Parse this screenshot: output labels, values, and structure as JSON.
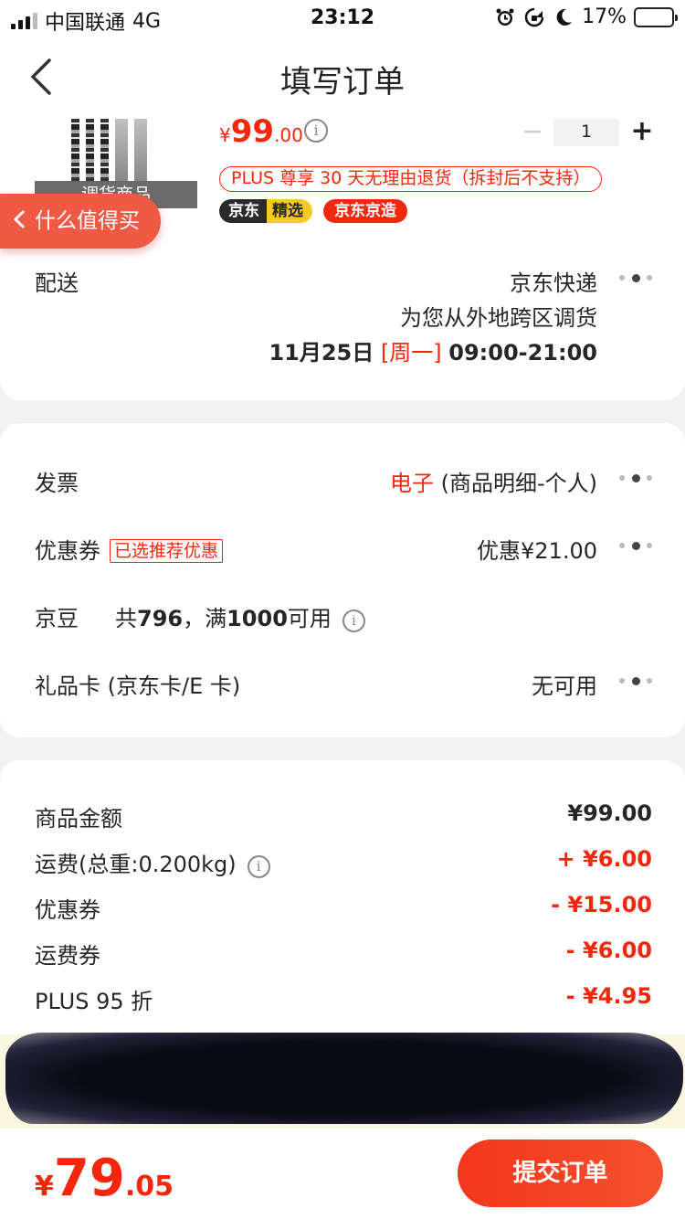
{
  "status_bar": {
    "carrier": "中国联通",
    "network": "4G",
    "time": "23:12",
    "battery": "17%",
    "battery_level": 0.17,
    "icons": [
      "signal-icon",
      "alarm-icon",
      "rotation-lock-icon",
      "moon-icon",
      "battery-icon"
    ]
  },
  "nav": {
    "title": "填写订单",
    "back_icon": "chevron-left-icon"
  },
  "product": {
    "image_tag": "调货商品",
    "price_yen": "¥",
    "price_int": "99",
    "price_dec": ".00",
    "quantity": "1",
    "minus_label": "−",
    "plus_label": "+",
    "plus_return_policy": "PLUS 尊享 30 天无理由退货（拆封后不支持）",
    "badge_jingxuan_a": "京东",
    "badge_jingxuan_b": "精选",
    "badge_jingzao": "京东京造"
  },
  "floating_button": {
    "label": "什么值得买",
    "icon": "chevron-left-icon"
  },
  "delivery": {
    "label": "配送",
    "carrier": "京东快递",
    "note": "为您从外地跨区调货",
    "date": "11月25日",
    "weekday": "[周一]",
    "time_window": "09:00-21:00"
  },
  "invoice": {
    "label": "发票",
    "type": "电子",
    "detail": "(商品明细-个人)"
  },
  "coupon": {
    "label": "优惠券",
    "tag": "已选推荐优惠",
    "value": "优惠¥21.00"
  },
  "jingdou": {
    "label": "京豆",
    "text_a": "共",
    "count": "796",
    "text_b": "，满",
    "threshold": "1000",
    "text_c": "可用"
  },
  "gift_card": {
    "label": "礼品卡 (京东卡/E 卡)",
    "value": "无可用"
  },
  "summary": [
    {
      "label": "商品金额",
      "value": "¥99.00",
      "red": false
    },
    {
      "label": "运费(总重:0.200kg)",
      "value": "+ ¥6.00",
      "red": true
    },
    {
      "label": "优惠券",
      "value": "- ¥15.00",
      "red": true
    },
    {
      "label": "运费券",
      "value": "- ¥6.00",
      "red": true
    },
    {
      "label": "PLUS 95 折",
      "value": "- ¥4.95",
      "red": true
    }
  ],
  "bottom": {
    "total_yen": "¥",
    "total_int": "79",
    "total_dec": ".05",
    "submit_label": "提交订单"
  },
  "colors": {
    "accent": "#f2270c",
    "float_button": "#f05a45",
    "background": "#f2f2f2"
  }
}
